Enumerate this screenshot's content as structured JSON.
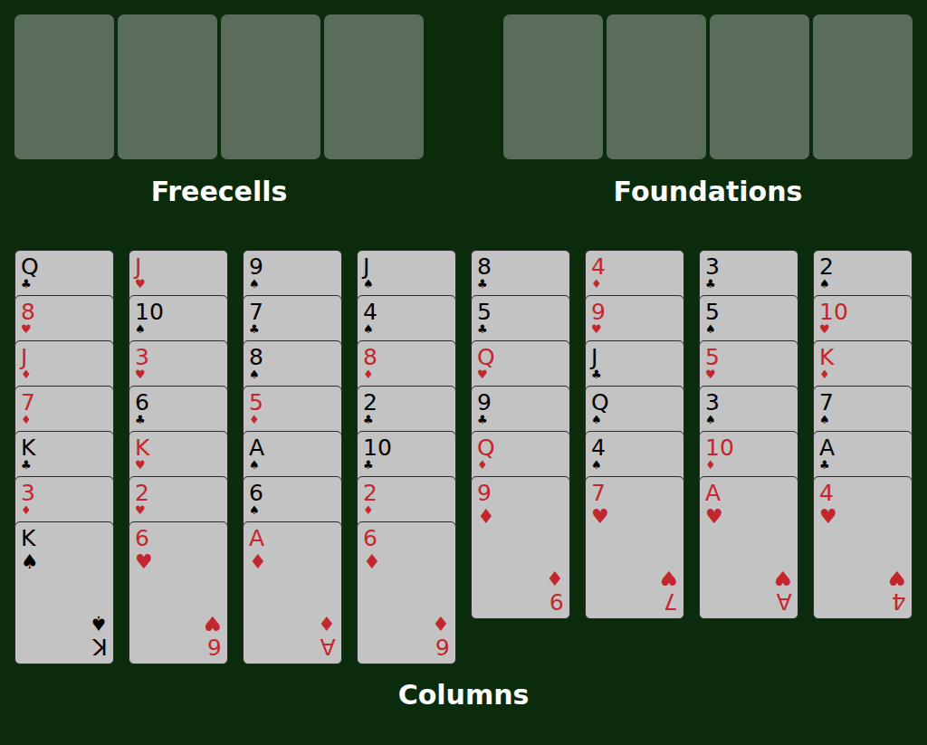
{
  "freecells": {
    "label": "Freecells",
    "slots": [
      {
        "empty": true
      },
      {
        "empty": true
      },
      {
        "empty": true
      },
      {
        "empty": true
      }
    ]
  },
  "foundations": {
    "label": "Foundations",
    "slots": [
      {
        "empty": true
      },
      {
        "empty": true
      },
      {
        "empty": true
      },
      {
        "empty": true
      }
    ]
  },
  "columns_label": "Columns",
  "columns": [
    {
      "cards": [
        {
          "rank": "Q",
          "suit": "♣",
          "color": "#000000"
        },
        {
          "rank": "8",
          "suit": "♥",
          "color": "#c4262e"
        },
        {
          "rank": "J",
          "suit": "♦",
          "color": "#c4262e"
        },
        {
          "rank": "7",
          "suit": "♦",
          "color": "#c4262e"
        },
        {
          "rank": "K",
          "suit": "♣",
          "color": "#000000"
        },
        {
          "rank": "3",
          "suit": "♦",
          "color": "#c4262e"
        },
        {
          "rank": "K",
          "suit": "♠",
          "color": "#000000"
        }
      ]
    },
    {
      "cards": [
        {
          "rank": "J",
          "suit": "♥",
          "color": "#c4262e"
        },
        {
          "rank": "10",
          "suit": "♠",
          "color": "#000000"
        },
        {
          "rank": "3",
          "suit": "♥",
          "color": "#c4262e"
        },
        {
          "rank": "6",
          "suit": "♣",
          "color": "#000000"
        },
        {
          "rank": "K",
          "suit": "♥",
          "color": "#c4262e"
        },
        {
          "rank": "2",
          "suit": "♥",
          "color": "#c4262e"
        },
        {
          "rank": "6",
          "suit": "♥",
          "color": "#c4262e"
        }
      ]
    },
    {
      "cards": [
        {
          "rank": "9",
          "suit": "♠",
          "color": "#000000"
        },
        {
          "rank": "7",
          "suit": "♣",
          "color": "#000000"
        },
        {
          "rank": "8",
          "suit": "♠",
          "color": "#000000"
        },
        {
          "rank": "5",
          "suit": "♦",
          "color": "#c4262e"
        },
        {
          "rank": "A",
          "suit": "♠",
          "color": "#000000"
        },
        {
          "rank": "6",
          "suit": "♠",
          "color": "#000000"
        },
        {
          "rank": "A",
          "suit": "♦",
          "color": "#c4262e"
        }
      ]
    },
    {
      "cards": [
        {
          "rank": "J",
          "suit": "♠",
          "color": "#000000"
        },
        {
          "rank": "4",
          "suit": "♠",
          "color": "#000000"
        },
        {
          "rank": "8",
          "suit": "♦",
          "color": "#c4262e"
        },
        {
          "rank": "2",
          "suit": "♣",
          "color": "#000000"
        },
        {
          "rank": "10",
          "suit": "♣",
          "color": "#000000"
        },
        {
          "rank": "2",
          "suit": "♦",
          "color": "#c4262e"
        },
        {
          "rank": "6",
          "suit": "♦",
          "color": "#c4262e"
        }
      ]
    },
    {
      "cards": [
        {
          "rank": "8",
          "suit": "♣",
          "color": "#000000"
        },
        {
          "rank": "5",
          "suit": "♣",
          "color": "#000000"
        },
        {
          "rank": "Q",
          "suit": "♥",
          "color": "#c4262e"
        },
        {
          "rank": "9",
          "suit": "♣",
          "color": "#000000"
        },
        {
          "rank": "Q",
          "suit": "♦",
          "color": "#c4262e"
        },
        {
          "rank": "9",
          "suit": "♦",
          "color": "#c4262e"
        }
      ]
    },
    {
      "cards": [
        {
          "rank": "4",
          "suit": "♦",
          "color": "#c4262e"
        },
        {
          "rank": "9",
          "suit": "♥",
          "color": "#c4262e"
        },
        {
          "rank": "J",
          "suit": "♣",
          "color": "#000000"
        },
        {
          "rank": "Q",
          "suit": "♠",
          "color": "#000000"
        },
        {
          "rank": "4",
          "suit": "♠",
          "color": "#000000"
        },
        {
          "rank": "7",
          "suit": "♥",
          "color": "#c4262e"
        }
      ]
    },
    {
      "cards": [
        {
          "rank": "3",
          "suit": "♣",
          "color": "#000000"
        },
        {
          "rank": "5",
          "suit": "♠",
          "color": "#000000"
        },
        {
          "rank": "5",
          "suit": "♥",
          "color": "#c4262e"
        },
        {
          "rank": "3",
          "suit": "♠",
          "color": "#000000"
        },
        {
          "rank": "10",
          "suit": "♦",
          "color": "#c4262e"
        },
        {
          "rank": "A",
          "suit": "♥",
          "color": "#c4262e"
        }
      ]
    },
    {
      "cards": [
        {
          "rank": "2",
          "suit": "♠",
          "color": "#000000"
        },
        {
          "rank": "10",
          "suit": "♥",
          "color": "#c4262e"
        },
        {
          "rank": "K",
          "suit": "♦",
          "color": "#c4262e"
        },
        {
          "rank": "7",
          "suit": "♠",
          "color": "#000000"
        },
        {
          "rank": "A",
          "suit": "♣",
          "color": "#000000"
        },
        {
          "rank": "4",
          "suit": "♥",
          "color": "#c4262e"
        }
      ]
    }
  ]
}
